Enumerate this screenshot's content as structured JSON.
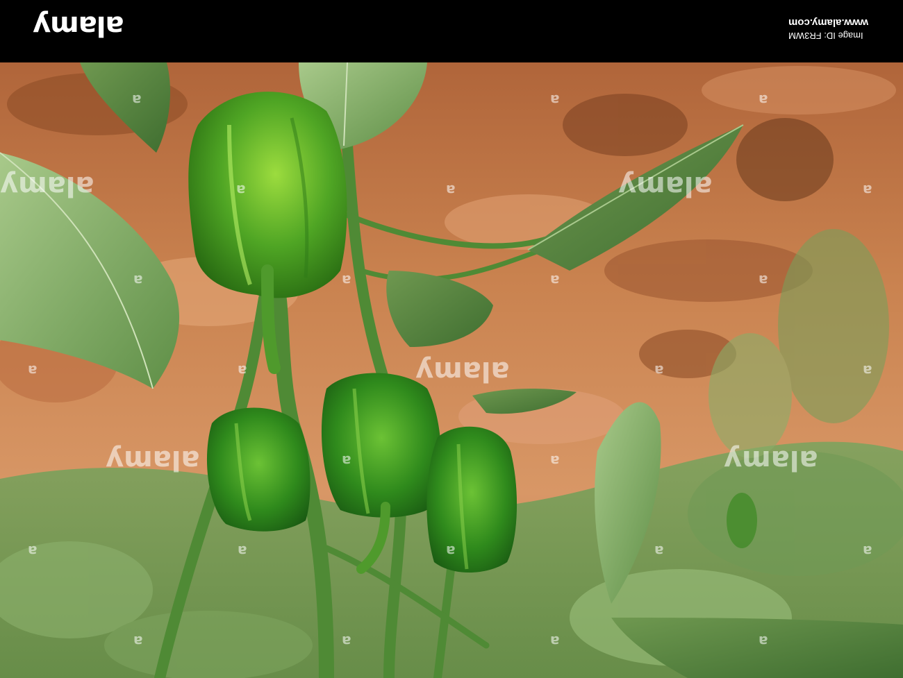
{
  "banner": {
    "logo": "alamy",
    "id_line": "Image ID: FR3WM",
    "site_line": "www.alamy.com"
  },
  "watermark": {
    "text": "alamy",
    "glyph": "a"
  }
}
